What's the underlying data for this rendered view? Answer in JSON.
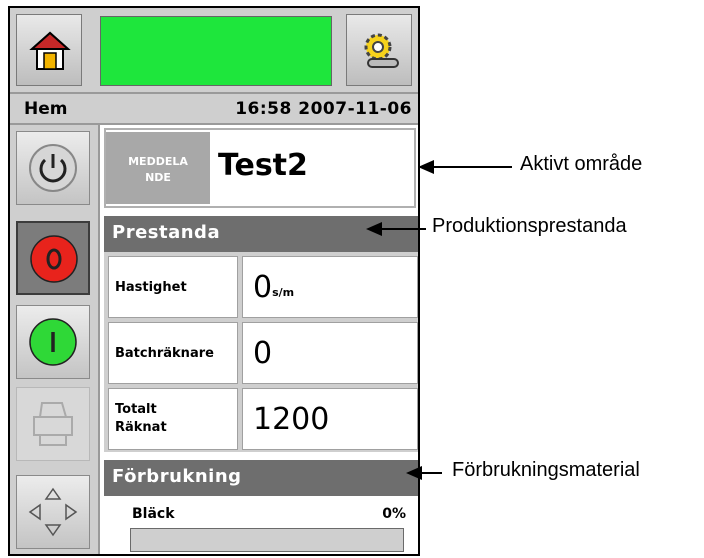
{
  "header": {
    "status_color": "#1ee63c"
  },
  "strip": {
    "page": "Hem",
    "datetime": "16:58 2007-11-06"
  },
  "message": {
    "label": "MEDDELANDE",
    "label_line1": "MEDDELA",
    "label_line2": "NDE",
    "value": "Test2"
  },
  "performance": {
    "title": "Prestanda",
    "speed_label": "Hastighet",
    "speed_value": "0",
    "speed_unit": "s/m",
    "batch_label": "Batchräknare",
    "batch_value": "0",
    "total_label_1": "Totalt",
    "total_label_2": "Räknat",
    "total_value": "1200"
  },
  "consumables": {
    "title": "Förbrukning",
    "ink_label": "Bläck",
    "ink_percent": "0%",
    "ink_level": 0
  },
  "callouts": {
    "active_area": "Aktivt område",
    "production": "Produktionsprestanda",
    "consumables": "Förbrukningsmaterial"
  },
  "icons": [
    "home-icon",
    "settings-icon",
    "power-icon",
    "stop-icon",
    "start-icon",
    "print-icon",
    "navigation-icon"
  ]
}
